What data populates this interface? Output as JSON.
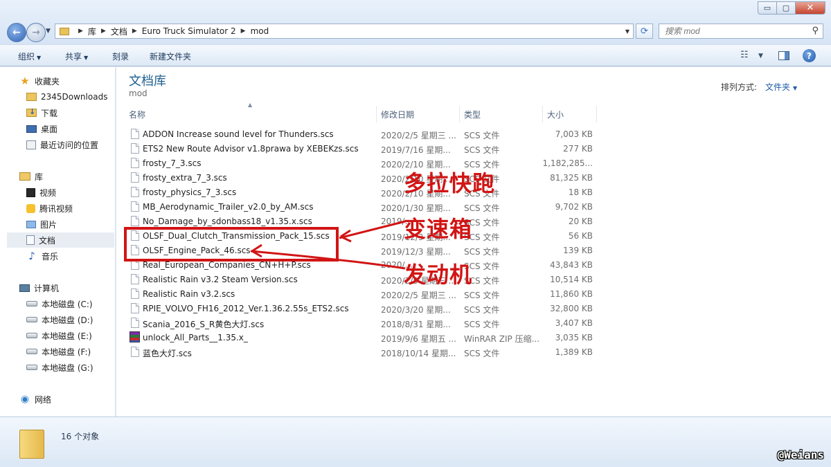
{
  "window": {
    "minimize_glyph": "▭",
    "maximize_glyph": "▢",
    "close_glyph": "✕"
  },
  "address": {
    "crumbs": [
      "库",
      "文档",
      "Euro Truck Simulator 2",
      "mod"
    ],
    "search_placeholder": "搜索 mod"
  },
  "toolbar": {
    "organize": "组织",
    "share": "共享",
    "burn": "刻录",
    "new_folder": "新建文件夹"
  },
  "sidebar": {
    "favorites": "收藏夹",
    "fav_items": [
      "2345Downloads",
      "下载",
      "桌面",
      "最近访问的位置"
    ],
    "libraries": "库",
    "lib_items": [
      "视频",
      "腾讯视频",
      "图片",
      "文档",
      "音乐"
    ],
    "computer": "计算机",
    "drives": [
      "本地磁盘 (C:)",
      "本地磁盘 (D:)",
      "本地磁盘 (E:)",
      "本地磁盘 (F:)",
      "本地磁盘 (G:)"
    ],
    "network": "网络",
    "selected": "文档"
  },
  "library": {
    "title": "文档库",
    "subtitle": "mod",
    "arrange_label": "排列方式:",
    "arrange_value": "文件夹"
  },
  "columns": {
    "name": "名称",
    "date": "修改日期",
    "type": "类型",
    "size": "大小"
  },
  "files": [
    {
      "name": "ADDON Increase sound level for Thunders.scs",
      "date": "2020/2/5 星期三 ...",
      "type": "SCS 文件",
      "size": "7,003 KB",
      "icon": "file-icon"
    },
    {
      "name": "ETS2 New Route Advisor v1.8prawa  by XEBEKzs.scs",
      "date": "2019/7/16 星期...",
      "type": "SCS 文件",
      "size": "277 KB",
      "icon": "file-icon"
    },
    {
      "name": "frosty_7_3.scs",
      "date": "2020/2/10 星期...",
      "type": "SCS 文件",
      "size": "1,182,285...",
      "icon": "file-icon"
    },
    {
      "name": "frosty_extra_7_3.scs",
      "date": "2020/2/10 星期...",
      "type": "SCS 文件",
      "size": "81,325 KB",
      "icon": "file-icon"
    },
    {
      "name": "frosty_physics_7_3.scs",
      "date": "2020/2/10 星期...",
      "type": "SCS 文件",
      "size": "18 KB",
      "icon": "file-icon"
    },
    {
      "name": "MB_Aerodynamic_Trailer_v2.0_by_AM.scs",
      "date": "2020/1/30 星期...",
      "type": "SCS 文件",
      "size": "9,702 KB",
      "icon": "file-icon"
    },
    {
      "name": "No_Damage_by_sdonbass18_v1.35.x.scs",
      "date": "2019/...",
      "type": "SCS 文件",
      "size": "20 KB",
      "icon": "file-icon"
    },
    {
      "name": "OLSF_Dual_Clutch_Transmission_Pack_15.scs",
      "date": "2019/12/3 星期...",
      "type": "SCS 文件",
      "size": "56 KB",
      "icon": "file-icon"
    },
    {
      "name": "OLSF_Engine_Pack_46.scs",
      "date": "2019/12/3 星期...",
      "type": "SCS 文件",
      "size": "139 KB",
      "icon": "file-icon"
    },
    {
      "name": "Real_European_Companies_CN+H+P.scs",
      "date": "2020/...",
      "type": "SCS 文件",
      "size": "43,843 KB",
      "icon": "file-icon"
    },
    {
      "name": "Realistic Rain v3.2 Steam Version.scs",
      "date": "2020/2/5 星期三 ...",
      "type": "SCS 文件",
      "size": "10,514 KB",
      "icon": "file-icon"
    },
    {
      "name": "Realistic Rain v3.2.scs",
      "date": "2020/2/5 星期三 ...",
      "type": "SCS 文件",
      "size": "11,860 KB",
      "icon": "file-icon"
    },
    {
      "name": "RPIE_VOLVO_FH16_2012_Ver.1.36.2.55s_ETS2.scs",
      "date": "2020/3/20 星期...",
      "type": "SCS 文件",
      "size": "32,800 KB",
      "icon": "file-icon"
    },
    {
      "name": "Scania_2016_S_R黄色大灯.scs",
      "date": "2018/8/31 星期...",
      "type": "SCS 文件",
      "size": "3,407 KB",
      "icon": "file-icon"
    },
    {
      "name": "unlock_All_Parts__1.35.x_",
      "date": "2019/9/6 星期五 ...",
      "type": "WinRAR ZIP 压缩...",
      "size": "3,035 KB",
      "icon": "winrar-zip-icon"
    },
    {
      "name": "蓝色大灯.scs",
      "date": "2018/10/14 星期...",
      "type": "SCS 文件",
      "size": "1,389 KB",
      "icon": "file-icon"
    }
  ],
  "annotations": {
    "label_1": "多拉快跑",
    "label_2": "变速箱",
    "label_3": "发动机",
    "color": "#d21414"
  },
  "status": {
    "count": "16 个对象"
  },
  "watermark": "@Weians"
}
